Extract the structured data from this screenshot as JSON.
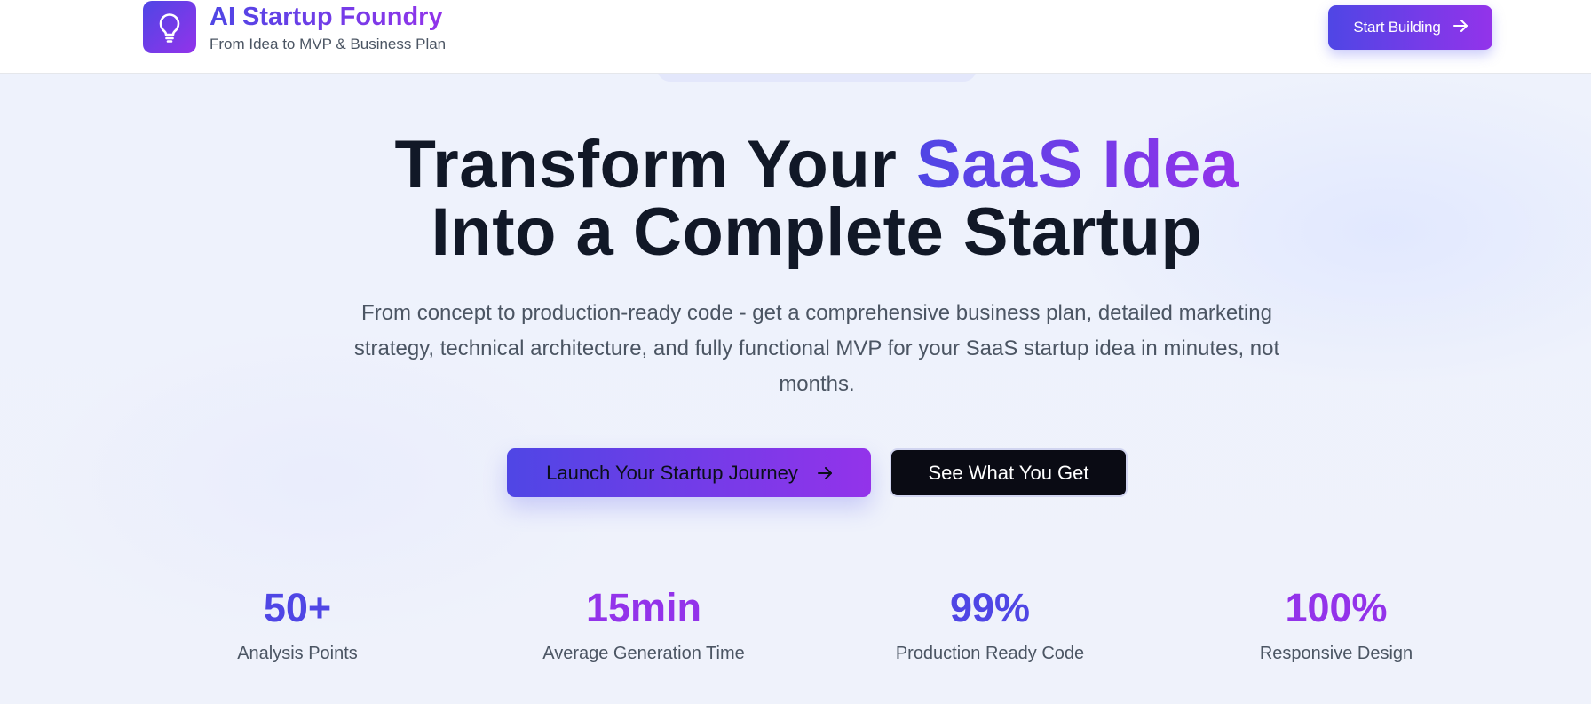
{
  "header": {
    "brand_title": "AI Startup Foundry",
    "brand_subtitle": "From Idea to MVP & Business Plan",
    "logo_icon": "lightbulb-icon",
    "start_button_label": "Start Building",
    "start_button_icon": "arrow-right-icon"
  },
  "hero": {
    "title_part1": "Transform Your ",
    "title_highlight": "SaaS Idea",
    "title_line2": "Into a Complete Startup",
    "description": "From concept to production-ready code - get a comprehensive business plan, detailed marketing strategy, technical architecture, and fully functional MVP for your SaaS startup idea in minutes, not months.",
    "primary_cta_label": "Launch Your Startup Journey",
    "secondary_cta_label": "See What You Get"
  },
  "stats": [
    {
      "value": "50+",
      "label": "Analysis Points"
    },
    {
      "value": "15min",
      "label": "Average Generation Time"
    },
    {
      "value": "99%",
      "label": "Production Ready Code"
    },
    {
      "value": "100%",
      "label": "Responsive Design"
    }
  ],
  "colors": {
    "gradient_start": "#4f46e5",
    "gradient_end": "#9333ea",
    "dark_button": "#0a0b14",
    "background": "#eef2fb"
  }
}
